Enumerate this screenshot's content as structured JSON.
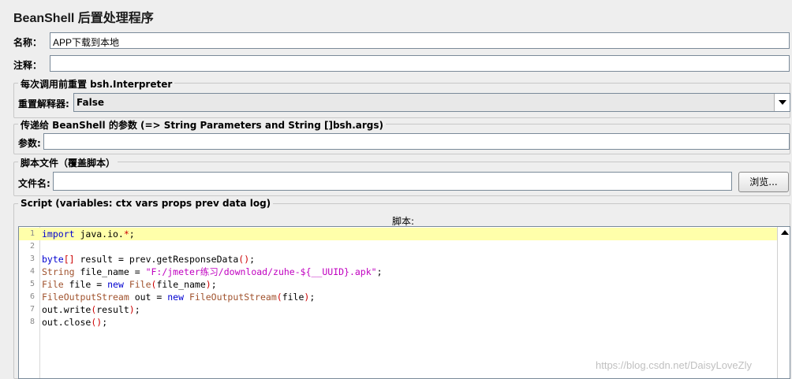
{
  "panel": {
    "title": "BeanShell 后置处理程序",
    "name_label": "名称：",
    "name_value": "APP下载到本地",
    "comment_label": "注释：",
    "comment_value": ""
  },
  "reset_group": {
    "legend": "每次调用前重置 bsh.Interpreter",
    "label": "重置解释器:",
    "selected": "False"
  },
  "params_group": {
    "legend": "传递给 BeanShell 的参数 (=> String Parameters and String []bsh.args)",
    "label": "参数:",
    "value": ""
  },
  "file_group": {
    "legend": "脚本文件（覆盖脚本）",
    "label": "文件名:",
    "value": "",
    "browse_label": "浏览..."
  },
  "script_group": {
    "legend": "Script (variables: ctx vars props prev data log)",
    "editor_title": "脚本:",
    "line_numbers": [
      "1",
      "2",
      "3",
      "4",
      "5",
      "6",
      "7",
      "8"
    ],
    "lines": [
      "import java.io.*;",
      "",
      "byte[] result = prev.getResponseData();",
      "String file_name = \"F:/jmeter练习/download/zuhe-${__UUID}.apk\";",
      "File file = new File(file_name);",
      "FileOutputStream out = new FileOutputStream(file);",
      "out.write(result);",
      "out.close();"
    ]
  },
  "watermark": "https://blog.csdn.net/DaisyLoveZly",
  "icons": {
    "dropdown": "chevron-down-icon",
    "scroll_up": "arrow-up-icon"
  },
  "colors": {
    "current_line": "#ffffaa",
    "keyword": "#0000d0",
    "string": "#c000c0",
    "type": "#a0522d"
  }
}
